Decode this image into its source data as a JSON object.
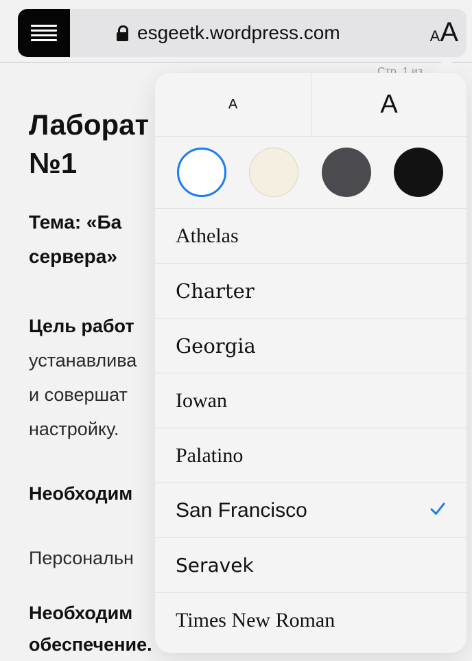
{
  "browser": {
    "url": "esgeetk.wordpress.com",
    "text_size_button": {
      "small": "A",
      "large": "A"
    }
  },
  "article": {
    "page_indicator": "Стр. 1 из",
    "title_lines": [
      "Лаборат",
      "№1"
    ],
    "topic_lines": [
      "Тема: «Ба",
      "сервера»"
    ],
    "goal_lines": [
      "Цель работ",
      "устанавлива",
      "и совершат",
      "настройку."
    ],
    "required_1": "Необходим",
    "personal": "Персональн",
    "required_2_lines": [
      "Необходим",
      "обеспечение."
    ]
  },
  "popover": {
    "text_size": {
      "smaller_label": "A",
      "larger_label": "A"
    },
    "themes": [
      {
        "name": "white",
        "color": "#ffffff",
        "selected": true
      },
      {
        "name": "sepia",
        "color": "#f5efe1",
        "selected": false
      },
      {
        "name": "gray",
        "color": "#4a4a4f",
        "selected": false
      },
      {
        "name": "night",
        "color": "#121212",
        "selected": false
      }
    ],
    "accent_color": "#1a7cf0",
    "fonts": [
      {
        "label": "Athelas",
        "selected": false
      },
      {
        "label": "Charter",
        "selected": false
      },
      {
        "label": "Georgia",
        "selected": false
      },
      {
        "label": "Iowan",
        "selected": false
      },
      {
        "label": "Palatino",
        "selected": false
      },
      {
        "label": "San Francisco",
        "selected": true
      },
      {
        "label": "Seravek",
        "selected": false
      },
      {
        "label": "Times New Roman",
        "selected": false
      }
    ]
  }
}
